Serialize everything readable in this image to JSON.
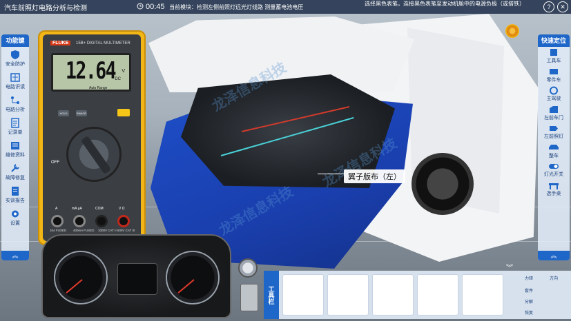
{
  "header": {
    "app_title": "汽车前照灯电路分析与检测",
    "timer": "00:45",
    "module_text": "当前模块：检测左侧前照灯远光灯线路  测量蓄电池电压",
    "instruction": "选择黑色表笔，连接黑色表笔至发动机舱中的电源负极（或搭铁）"
  },
  "left_bar": {
    "title": "功能键",
    "items": [
      {
        "label": "安全防护"
      },
      {
        "label": "电路识读"
      },
      {
        "label": "电路分析"
      },
      {
        "label": "记录单"
      },
      {
        "label": "维修资料"
      },
      {
        "label": "故障修复"
      },
      {
        "label": "实训报告"
      },
      {
        "label": "设置"
      }
    ]
  },
  "right_bar": {
    "title": "快速定位",
    "items": [
      {
        "label": "工具车"
      },
      {
        "label": "零件车"
      },
      {
        "label": "主驾驶"
      },
      {
        "label": "左前车门"
      },
      {
        "label": "左前照灯"
      },
      {
        "label": "整车"
      },
      {
        "label": "灯光开关"
      },
      {
        "label": "选手桌"
      }
    ]
  },
  "multimeter": {
    "brand": "FLUKE",
    "model": "15B+ DIGITAL MULTIMETER",
    "reading": "12.64",
    "unit": "V",
    "mode": "DC",
    "range_text": "Auto Range",
    "hold_label": "HOLD",
    "range_label": "RANGE",
    "off_label": "OFF",
    "jacks": [
      {
        "label": "A"
      },
      {
        "label": "mA µA"
      },
      {
        "label": "COM"
      },
      {
        "label": "V Ω"
      }
    ],
    "fuse_texts": [
      "10A FUSED",
      "400mA FUSED",
      "1000V CAT II 600V CAT III"
    ]
  },
  "scene": {
    "callout": "翼子版布（左）",
    "watermark": "龙泽信息科技"
  },
  "toolbar": {
    "tab_label": "工具栏",
    "side_buttons": [
      "力矩",
      "方向",
      "套件",
      "分解",
      "恢复"
    ]
  },
  "colors": {
    "accent_blue": "#1e66c8",
    "meter_yellow": "#f2b616",
    "fender_cover_blue": "#1a3fae"
  }
}
